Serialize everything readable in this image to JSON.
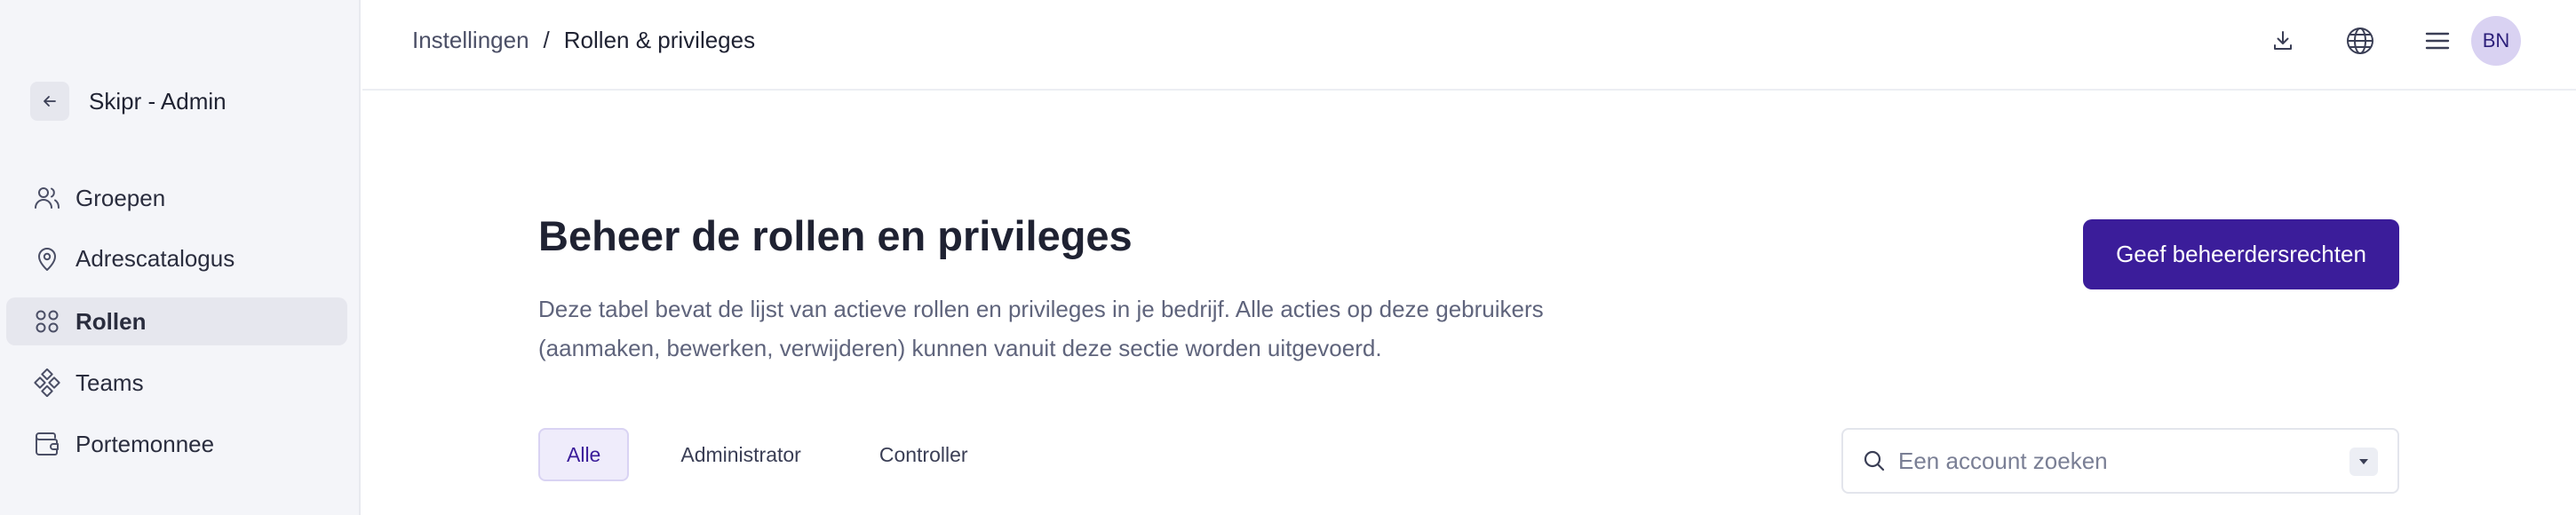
{
  "sidebar": {
    "app_name": "Skipr - Admin",
    "back_icon": "arrow-left-icon",
    "items": [
      {
        "label": "Groepen",
        "icon": "users-icon",
        "active": false
      },
      {
        "label": "Adrescatalogus",
        "icon": "map-pin-icon",
        "active": false
      },
      {
        "label": "Rollen",
        "icon": "grid-icon",
        "active": true
      },
      {
        "label": "Teams",
        "icon": "diamond-nodes-icon",
        "active": false
      },
      {
        "label": "Portemonnee",
        "icon": "wallet-icon",
        "active": false
      }
    ]
  },
  "header": {
    "breadcrumb": {
      "parent": "Instellingen",
      "separator": "/",
      "current": "Rollen & privileges"
    },
    "icons": [
      "download-icon",
      "globe-icon",
      "menu-icon"
    ],
    "avatar_initials": "BN"
  },
  "main": {
    "title": "Beheer de rollen en privileges",
    "description": "Deze tabel bevat de lijst van actieve rollen en privileges in je bedrijf. Alle acties op deze gebruikers (aanmaken, bewerken, verwijderen) kunnen vanuit deze sectie worden uitgevoerd.",
    "primary_button": "Geef beheerdersrechten",
    "tabs": [
      {
        "label": "Alle",
        "active": true
      },
      {
        "label": "Administrator",
        "active": false
      },
      {
        "label": "Controller",
        "active": false
      }
    ],
    "search": {
      "placeholder": "Een account zoeken",
      "value": ""
    }
  },
  "colors": {
    "primary": "#3b1d9a",
    "sidebar_bg": "#f4f5f9",
    "active_item_bg": "#e6e7ee",
    "avatar_bg": "#d9d2f2"
  }
}
